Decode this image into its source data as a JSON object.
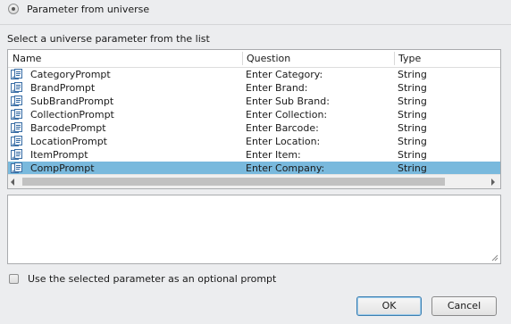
{
  "radio": {
    "label": "Parameter from universe",
    "selected": true
  },
  "section_label": "Select a universe parameter from the list",
  "table": {
    "columns": [
      "Name",
      "Question",
      "Type"
    ],
    "rows": [
      {
        "name": "CategoryPrompt",
        "question": "Enter Category:",
        "type": "String"
      },
      {
        "name": "BrandPrompt",
        "question": "Enter Brand:",
        "type": "String"
      },
      {
        "name": "SubBrandPrompt",
        "question": "Enter Sub Brand:",
        "type": "String"
      },
      {
        "name": "CollectionPrompt",
        "question": "Enter Collection:",
        "type": "String"
      },
      {
        "name": "BarcodePrompt",
        "question": "Enter Barcode:",
        "type": "String"
      },
      {
        "name": "LocationPrompt",
        "question": "Enter Location:",
        "type": "String"
      },
      {
        "name": "ItemPrompt",
        "question": "Enter Item:",
        "type": "String"
      },
      {
        "name": "CompPrompt",
        "question": "Enter Company:",
        "type": "String"
      }
    ],
    "selected_index": 7,
    "row_icon": "parameter-icon"
  },
  "description": "",
  "optional_checkbox": {
    "label": "Use the selected parameter as an optional prompt",
    "checked": false
  },
  "buttons": {
    "ok": "OK",
    "cancel": "Cancel"
  },
  "colors": {
    "selection": "#79b9dd",
    "background": "#ecedef"
  }
}
